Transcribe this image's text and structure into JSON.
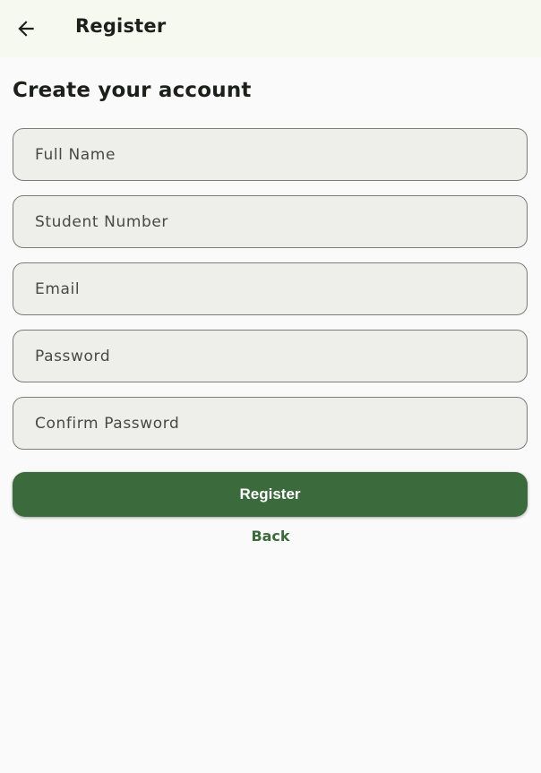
{
  "appbar": {
    "title": "Register",
    "back_icon": "arrow-left-icon"
  },
  "heading": "Create your account",
  "form": {
    "full_name": {
      "placeholder": "Full Name",
      "value": ""
    },
    "student_number": {
      "placeholder": "Student Number",
      "value": ""
    },
    "email": {
      "placeholder": "Email",
      "value": ""
    },
    "password": {
      "placeholder": "Password",
      "value": ""
    },
    "confirm_password": {
      "placeholder": "Confirm Password",
      "value": ""
    }
  },
  "actions": {
    "register_label": "Register",
    "back_label": "Back"
  },
  "colors": {
    "primary": "#3b6a3c",
    "appbar_bg": "#f6f9ef",
    "field_bg": "#eeefea",
    "page_bg": "#fafafa"
  }
}
